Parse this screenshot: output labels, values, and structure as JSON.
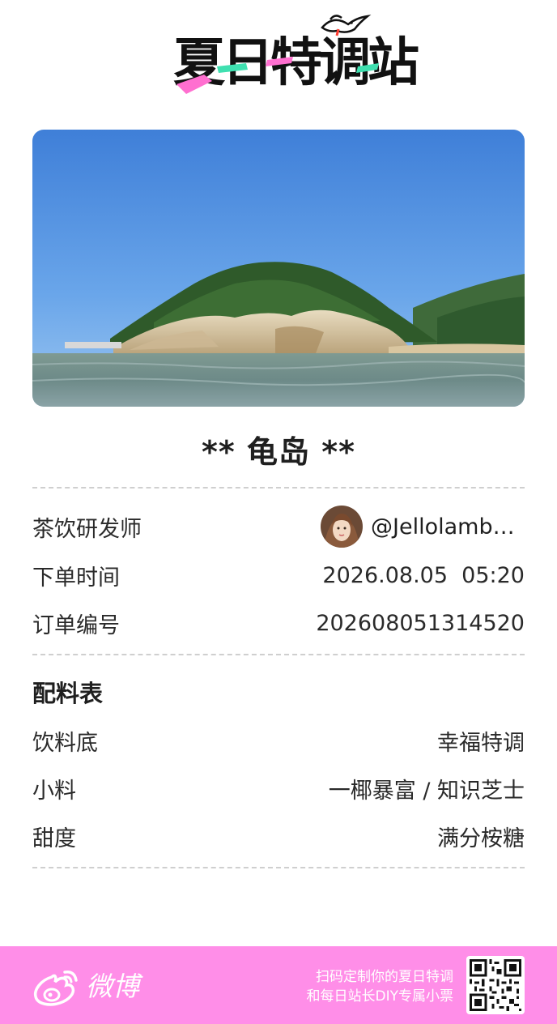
{
  "header": {
    "logo_text": "夏日特调站",
    "logo_icon": "seagull-icon"
  },
  "hero": {
    "image_name": "island-photo"
  },
  "title": "** 龟岛 **",
  "info": {
    "designer_label": "茶饮研发师",
    "designer_handle": "@Jellolambu…",
    "time_label": "下单时间",
    "time_value": "2026.08.05  05:20",
    "order_label": "订单编号",
    "order_value": "202608051314520"
  },
  "ingredients": {
    "section_title": "配料表",
    "items": [
      {
        "label": "饮料底",
        "value": "幸福特调"
      },
      {
        "label": "小料",
        "value": "一椰暴富 / 知识芝士"
      },
      {
        "label": "甜度",
        "value": "满分桉糖"
      }
    ]
  },
  "footer": {
    "brand": "微博",
    "promo_line1": "扫码定制你的夏日特调",
    "promo_line2": "和每日站长DIY专属小票"
  },
  "colors": {
    "footer_bg": "#ff8ee8",
    "accent_pink": "#ff6fd0",
    "accent_green": "#3fe0b0"
  }
}
